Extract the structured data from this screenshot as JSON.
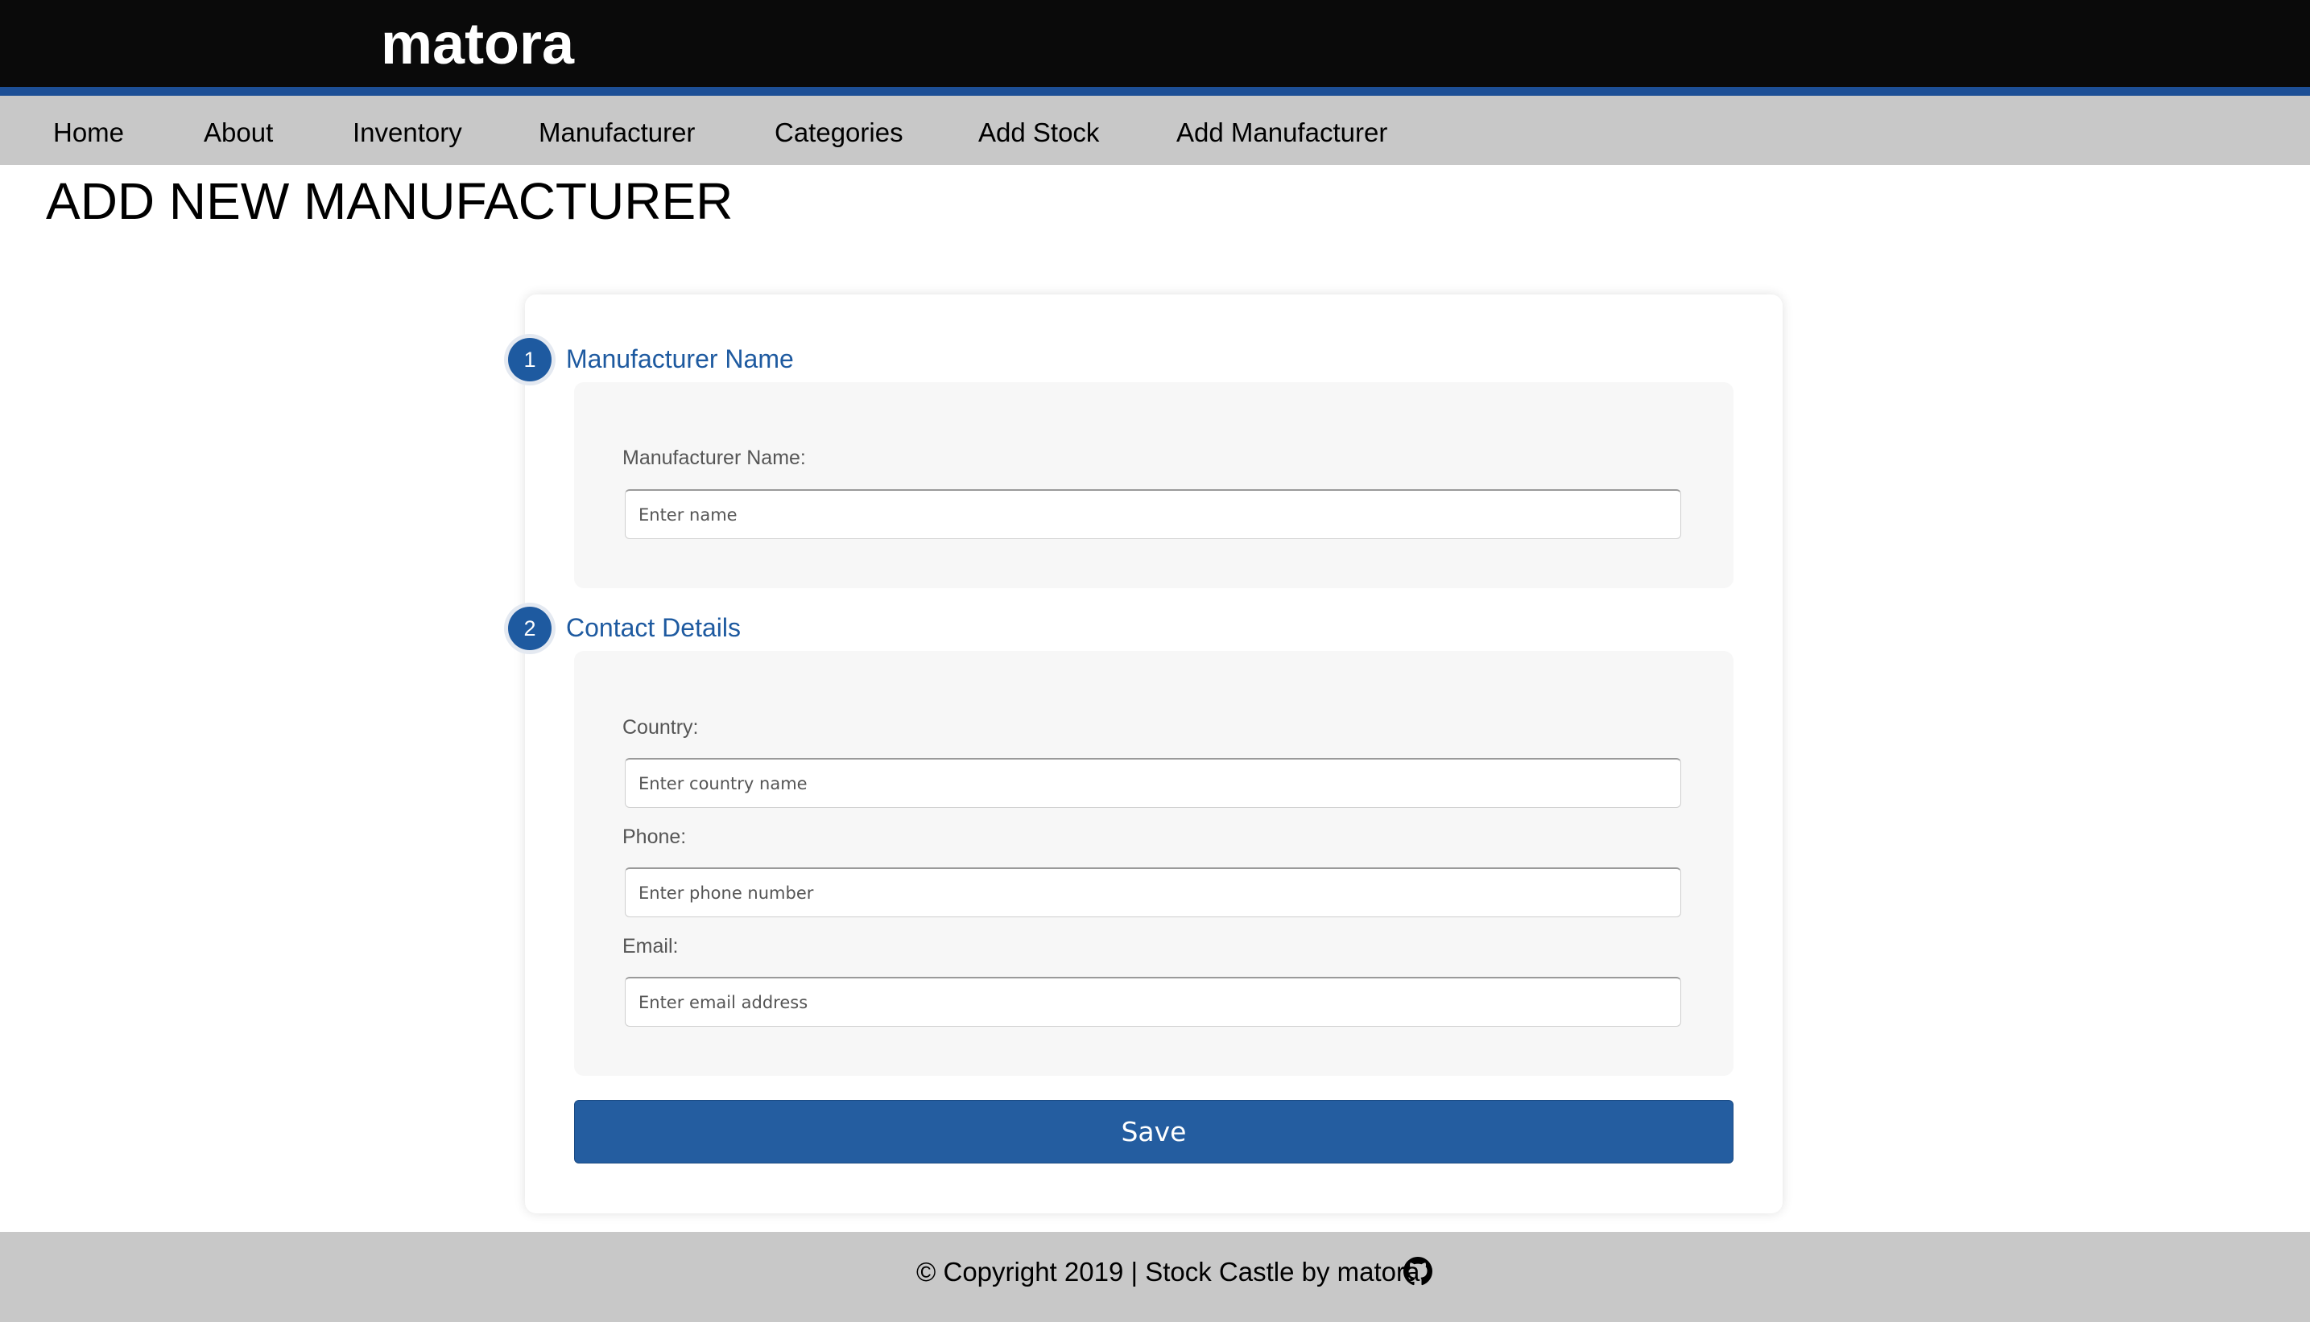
{
  "header": {
    "brand": "matora"
  },
  "nav": {
    "items": [
      {
        "label": "Home"
      },
      {
        "label": "About"
      },
      {
        "label": "Inventory"
      },
      {
        "label": "Manufacturer"
      },
      {
        "label": "Categories"
      },
      {
        "label": "Add Stock"
      },
      {
        "label": "Add Manufacturer"
      }
    ]
  },
  "page": {
    "title": "ADD NEW MANUFACTURER"
  },
  "form": {
    "sections": [
      {
        "number": "1",
        "title": "Manufacturer Name",
        "fields": [
          {
            "label": "Manufacturer Name:",
            "placeholder": "Enter name",
            "value": ""
          }
        ]
      },
      {
        "number": "2",
        "title": "Contact Details",
        "fields": [
          {
            "label": "Country:",
            "placeholder": "Enter country name",
            "value": ""
          },
          {
            "label": "Phone:",
            "placeholder": "Enter phone number",
            "value": ""
          },
          {
            "label": "Email:",
            "placeholder": "Enter email address",
            "value": ""
          }
        ]
      }
    ],
    "save_label": "Save"
  },
  "footer": {
    "text": "© Copyright 2019 | Stock Castle by matora",
    "icon": "github-icon"
  },
  "colors": {
    "header_bg": "#0a0a0a",
    "header_accent": "#1d4f96",
    "nav_bg": "#c8c8c8",
    "primary": "#1e5aa0",
    "panel_bg": "#f7f7f7",
    "footer_bg": "#c8c8c8"
  }
}
